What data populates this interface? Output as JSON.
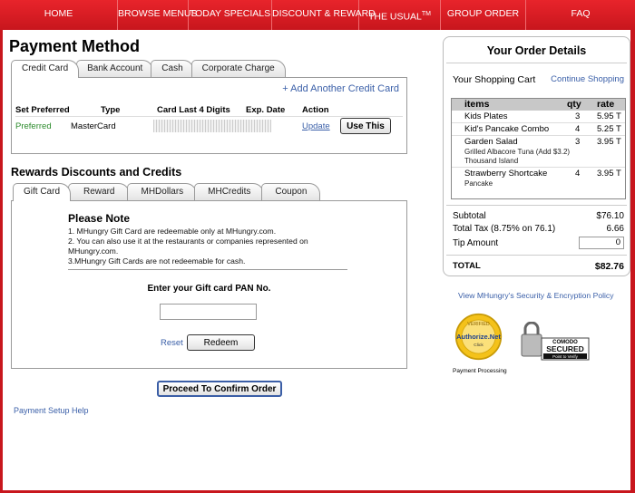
{
  "nav": [
    {
      "label": "HOME"
    },
    {
      "label": "BROWSE MENUS"
    },
    {
      "label": "TODAY SPECIALS"
    },
    {
      "label": "DISCOUNT & REWARD"
    },
    {
      "label": "THE USUAL",
      "sup": "TM"
    },
    {
      "label": "GROUP ORDER"
    },
    {
      "label": "FAQ"
    }
  ],
  "payment": {
    "title": "Payment Method",
    "tabs": [
      "Credit Card",
      "Bank Account",
      "Cash",
      "Corporate Charge"
    ],
    "add_card": "+ Add Another Credit Card",
    "columns": [
      "Set Preferred",
      "Type",
      "Card Last 4 Digits",
      "Exp. Date",
      "Action"
    ],
    "row": {
      "preferred": "Preferred",
      "type": "MasterCard",
      "update": "Update",
      "use_button": "Use This"
    }
  },
  "rewards": {
    "title": "Rewards Discounts and Credits",
    "tabs": [
      "Gift Card",
      "Reward",
      "MHDollars",
      "MHCredits",
      "Coupon"
    ],
    "note_title": "Please Note",
    "note_lines": [
      "1. MHungry Gift Card are redeemable only at MHungry.com.",
      "2. You can also use it at the restaurants or companies represented on MHungry.com.",
      "3.MHungry Gift Cards are not redeemable for cash."
    ],
    "pan_label": "Enter your Gift card PAN No.",
    "pan_value": "",
    "reset": "Reset",
    "redeem": "Redeem"
  },
  "proceed_button": "Proceed To Confirm Order",
  "help_link": "Payment Setup Help",
  "order": {
    "title": "Your Order Details",
    "cart_label": "Your Shopping Cart",
    "continue": "Continue Shopping",
    "headers": [
      "items",
      "qty",
      "rate"
    ],
    "items": [
      {
        "name": "Kids Plates",
        "sub": "",
        "qty": "3",
        "rate": "5.95 T"
      },
      {
        "name": "Kid's Pancake Combo",
        "sub": "",
        "qty": "4",
        "rate": "5.25 T"
      },
      {
        "name": "Garden Salad",
        "sub": "Grilled Albacore Tuna (Add $3.2) Thousand Island",
        "qty": "3",
        "rate": "3.95 T"
      },
      {
        "name": "Strawberry Shortcake",
        "sub": "Pancake",
        "qty": "4",
        "rate": "3.95 T"
      }
    ],
    "subtotal_label": "Subtotal",
    "subtotal": "$76.10",
    "tax_label": "Total Tax (8.75% on 76.1)",
    "tax": "6.66",
    "tip_label": "Tip Amount",
    "tip": "0",
    "total_label": "TOTAL",
    "total": "$82.76"
  },
  "policy_link": "View MHungry's Security & Encryption Policy",
  "authorize": {
    "line1": "Authorize.Net",
    "line2": "Click",
    "top": "VERIFIED",
    "caption": "Payment Processing"
  },
  "comodo": {
    "brand": "COMODO",
    "secured": "SECURED",
    "verify": "Point to Verify"
  },
  "colors": {
    "brand_red": "#c8161d",
    "link_blue": "#3a5fa8",
    "preferred_green": "#2a8a2a"
  }
}
